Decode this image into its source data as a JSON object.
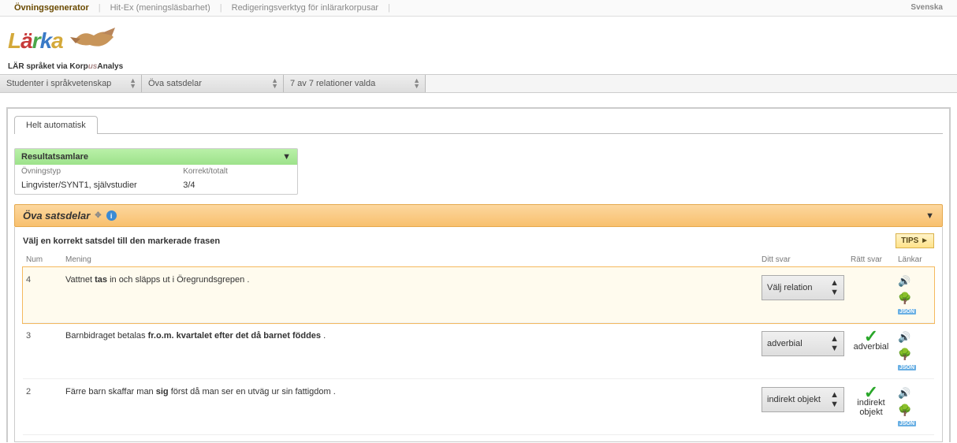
{
  "nav": {
    "items": [
      "Övningsgenerator",
      "Hit-Ex (meningsläsbarhet)",
      "Redigeringsverktyg för inlärarkorpusar"
    ],
    "active_index": 0,
    "language": "Svenska"
  },
  "logo": {
    "name": "Lärka",
    "tagline_pre": "LÄR språket via Korp",
    "tagline_mid": "us",
    "tagline_post": "Analys"
  },
  "selectors": {
    "audience": "Studenter i språkvetenskap",
    "exercise": "Öva satsdelar",
    "relations": "7 av 7 relationer valda"
  },
  "tab": {
    "label": "Helt automatisk"
  },
  "results": {
    "title": "Resultatsamlare",
    "col_type": "Övningstyp",
    "col_score": "Korrekt/totalt",
    "row_type": "Lingvister/SYNT1, självstudier",
    "row_score": "3/4"
  },
  "exercise": {
    "title": "Öva satsdelar",
    "instruction": "Välj en korrekt satsdel till den markerade frasen",
    "tips_label": "TIPS ►",
    "headers": {
      "num": "Num",
      "sentence": "Mening",
      "answer": "Ditt svar",
      "correct": "Rätt svar",
      "links": "Länkar"
    },
    "rows": [
      {
        "num": "4",
        "sentence_parts": [
          "Vattnet ",
          "tas",
          " in och släpps ut i Öregrundsgrepen ."
        ],
        "bold_index": 1,
        "answer_selected": "Välj relation",
        "correct": "",
        "show_check": false,
        "highlight": true
      },
      {
        "num": "3",
        "sentence_parts": [
          "Barnbidraget betalas ",
          "fr.o.m. kvartalet efter det då barnet föddes",
          " ."
        ],
        "bold_index": 1,
        "answer_selected": "adverbial",
        "correct": "adverbial",
        "show_check": true,
        "highlight": false
      },
      {
        "num": "2",
        "sentence_parts": [
          "Färre barn skaffar man ",
          "sig",
          " först då man ser en utväg ur sin fattigdom ."
        ],
        "bold_index": 1,
        "answer_selected": "indirekt objekt",
        "correct": "indirekt objekt",
        "show_check": true,
        "highlight": false
      }
    ],
    "json_badge": "JSON"
  }
}
